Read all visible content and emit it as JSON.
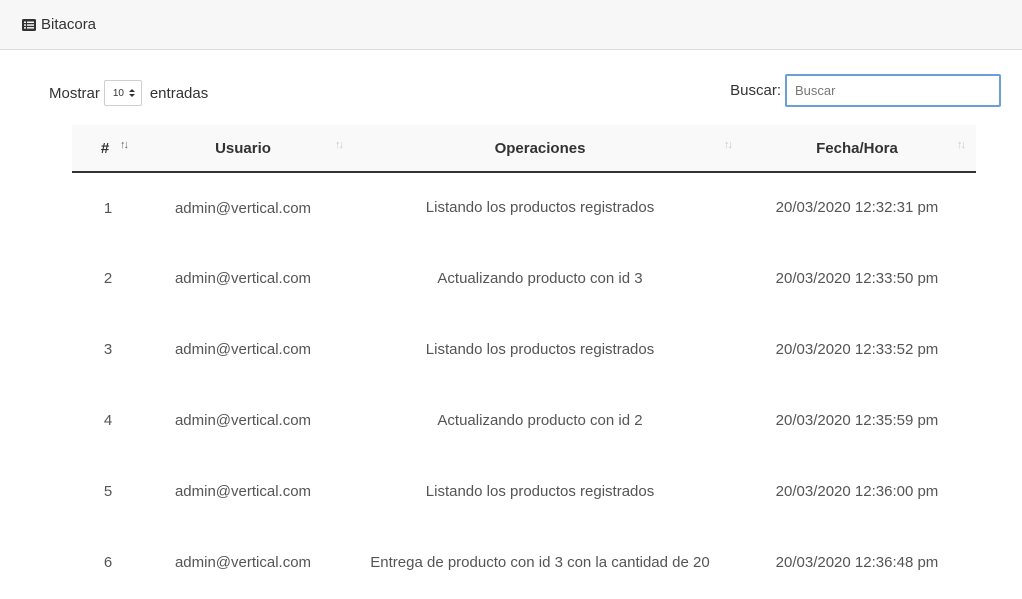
{
  "header": {
    "title": "Bitacora",
    "icon": "list-icon"
  },
  "controls": {
    "show_label": "Mostrar",
    "page_length": "10",
    "entries_label": "entradas",
    "search_label": "Buscar:",
    "search_placeholder": "Buscar"
  },
  "table": {
    "columns": [
      {
        "label": "#"
      },
      {
        "label": "Usuario"
      },
      {
        "label": "Operaciones"
      },
      {
        "label": "Fecha/Hora"
      }
    ],
    "sort_glyph": "↑↓",
    "rows": [
      {
        "num": "1",
        "user": "admin@vertical.com",
        "operation": "Listando los productos registrados",
        "datetime": "20/03/2020 12:32:31 pm"
      },
      {
        "num": "2",
        "user": "admin@vertical.com",
        "operation": "Actualizando producto con id 3",
        "datetime": "20/03/2020 12:33:50 pm"
      },
      {
        "num": "3",
        "user": "admin@vertical.com",
        "operation": "Listando los productos registrados",
        "datetime": "20/03/2020 12:33:52 pm"
      },
      {
        "num": "4",
        "user": "admin@vertical.com",
        "operation": "Actualizando producto con id 2",
        "datetime": "20/03/2020 12:35:59 pm"
      },
      {
        "num": "5",
        "user": "admin@vertical.com",
        "operation": "Listando los productos registrados",
        "datetime": "20/03/2020 12:36:00 pm"
      },
      {
        "num": "6",
        "user": "admin@vertical.com",
        "operation": "Entrega de producto con id 3 con la cantidad de 20",
        "datetime": "20/03/2020 12:36:48 pm"
      }
    ]
  },
  "colors": {
    "search_border": "#6aa0d8",
    "header_bg": "#f7f7f7"
  }
}
